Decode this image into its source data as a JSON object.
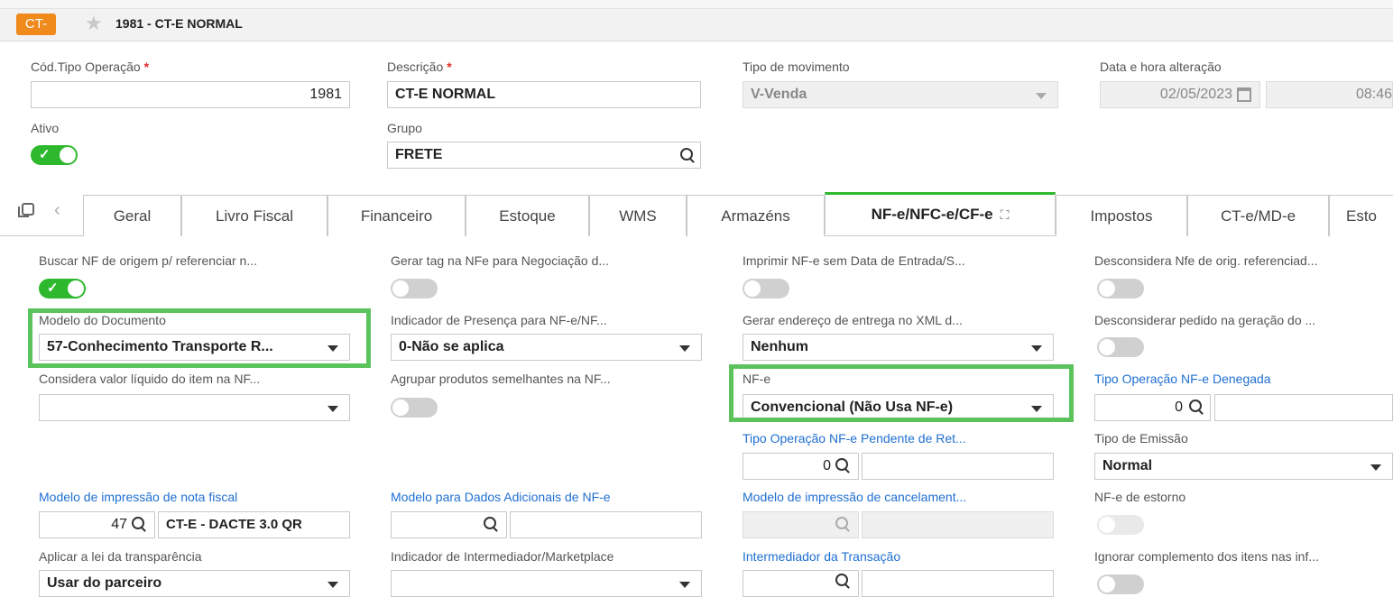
{
  "header": {
    "badge": "CT-",
    "title": "1981 - CT-E NORMAL"
  },
  "form": {
    "cod_tipo_label": "Cód.Tipo Operação",
    "cod_tipo_value": "1981",
    "descricao_label": "Descrição",
    "descricao_value": "CT-E NORMAL",
    "tipo_mov_label": "Tipo de movimento",
    "tipo_mov_value": "V-Venda",
    "data_label": "Data e hora alteração",
    "data_value": "02/05/2023",
    "hora_value": "08:46",
    "ativo_label": "Ativo",
    "grupo_label": "Grupo",
    "grupo_value": "FRETE"
  },
  "tabs": [
    "Geral",
    "Livro Fiscal",
    "Financeiro",
    "Estoque",
    "WMS",
    "Armazéns",
    "NF-e/NFC-e/CF-e",
    "Impostos",
    "CT-e/MD-e",
    "Esto"
  ],
  "fields": {
    "buscar_nf": "Buscar NF de origem p/ referenciar n...",
    "gerar_tag": "Gerar tag na NFe para Negociação d...",
    "imprimir_nfe": "Imprimir NF-e sem Data de Entrada/S...",
    "desconsidera_nfe": "Desconsidera Nfe de orig. referenciad...",
    "modelo_doc_label": "Modelo do Documento",
    "modelo_doc_value": "57-Conhecimento Transporte R...",
    "ind_presenca_label": "Indicador de Presença para NF-e/NF...",
    "ind_presenca_value": "0-Não se aplica",
    "gerar_end_label": "Gerar endereço de entrega no XML d...",
    "gerar_end_value": "Nenhum",
    "desconsiderar_ped": "Desconsiderar pedido na geração do ...",
    "considera_valor": "Considera valor líquido do item na NF...",
    "agrupar": "Agrupar produtos semelhantes na NF...",
    "nfe_label": "NF-e",
    "nfe_value": "Convencional (Não Usa NF-e)",
    "tipo_op_denegada_label": "Tipo Operação NF-e Denegada",
    "tipo_op_denegada_value": "0",
    "tipo_op_pendente_label": "Tipo Operação NF-e Pendente de Ret...",
    "tipo_op_pendente_value": "0",
    "tipo_emissao_label": "Tipo de Emissão",
    "tipo_emissao_value": "Normal",
    "modelo_impr_label": "Modelo de impressão de nota fiscal",
    "modelo_impr_code": "47",
    "modelo_impr_desc": "CT-E - DACTE 3.0 QR",
    "modelo_dados_label": "Modelo para Dados Adicionais de NF-e",
    "modelo_cancel_label": "Modelo de impressão de cancelament...",
    "nfe_estorno_label": "NF-e de estorno",
    "aplicar_lei_label": "Aplicar a lei da transparência",
    "aplicar_lei_value": "Usar do parceiro",
    "ind_intermed_label": "Indicador de Intermediador/Marketplace",
    "intermed_transacao_label": "Intermediador da Transação",
    "ignorar_label": "Ignorar complemento dos itens nas inf..."
  },
  "colors": {
    "accent": "#2db82d",
    "badge": "#f08a1c",
    "link": "#1f6fd1",
    "highlight": "#5bc35b"
  }
}
